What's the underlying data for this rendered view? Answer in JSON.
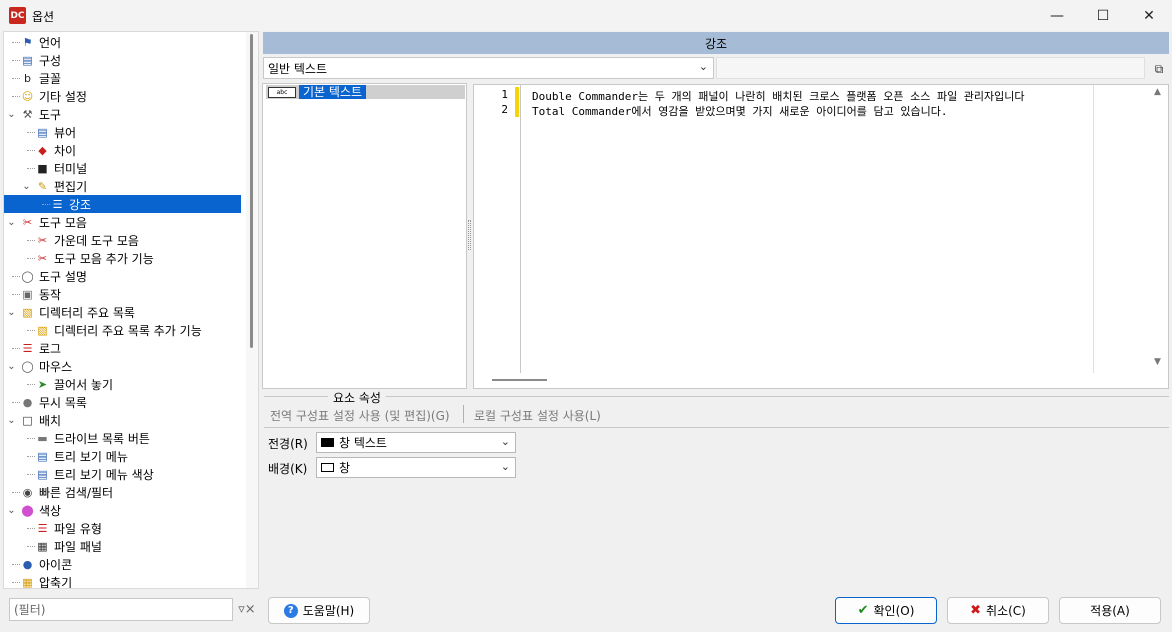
{
  "window": {
    "title": "옵션",
    "app_icon_text": "DC"
  },
  "header": {
    "title": "강조"
  },
  "syntax_combo": {
    "value": "일반 텍스트"
  },
  "tree": {
    "items": [
      {
        "label": "언어",
        "icon": "flag-icon",
        "level": 1
      },
      {
        "label": "구성",
        "icon": "config-icon",
        "level": 1
      },
      {
        "label": "글꼴",
        "icon": "font-icon",
        "level": 1
      },
      {
        "label": "기타 설정",
        "icon": "smiley-icon",
        "level": 1
      },
      {
        "label": "도구",
        "icon": "tools-icon",
        "level": 1,
        "expanded": true
      },
      {
        "label": "뷰어",
        "icon": "book-icon",
        "level": 2
      },
      {
        "label": "차이",
        "icon": "diff-icon",
        "level": 2
      },
      {
        "label": "터미널",
        "icon": "terminal-icon",
        "level": 2
      },
      {
        "label": "편집기",
        "icon": "editor-icon",
        "level": 2,
        "expanded": true
      },
      {
        "label": "강조",
        "icon": "list-icon",
        "level": 3,
        "selected": true
      },
      {
        "label": "도구 모음",
        "icon": "scissors-icon",
        "level": 1,
        "expanded": true
      },
      {
        "label": "가운데 도구 모음",
        "icon": "scissors-icon",
        "level": 2
      },
      {
        "label": "도구 모음 추가 기능",
        "icon": "scissors-icon",
        "level": 2
      },
      {
        "label": "도구 설명",
        "icon": "bulb-icon",
        "level": 1
      },
      {
        "label": "동작",
        "icon": "action-icon",
        "level": 1
      },
      {
        "label": "디렉터리 주요 목록",
        "icon": "folder-icon",
        "level": 1,
        "expanded": true
      },
      {
        "label": "디렉터리 주요 목록 추가 기능",
        "icon": "folder-icon",
        "level": 2
      },
      {
        "label": "로그",
        "icon": "log-icon",
        "level": 1
      },
      {
        "label": "마우스",
        "icon": "mouse-icon",
        "level": 1,
        "expanded": true
      },
      {
        "label": "끌어서 놓기",
        "icon": "drag-icon",
        "level": 2
      },
      {
        "label": "무시 목록",
        "icon": "ignore-icon",
        "level": 1
      },
      {
        "label": "배치",
        "icon": "layout-icon",
        "level": 1,
        "expanded": true
      },
      {
        "label": "드라이브 목록 버튼",
        "icon": "drive-icon",
        "level": 2
      },
      {
        "label": "트리 보기 메뉴",
        "icon": "tree-menu-icon",
        "level": 2
      },
      {
        "label": "트리 보기 메뉴 색상",
        "icon": "tree-menu-icon",
        "level": 2
      },
      {
        "label": "빠른 검색/필터",
        "icon": "binoculars-icon",
        "level": 1
      },
      {
        "label": "색상",
        "icon": "color-wheel-icon",
        "level": 1,
        "expanded": true
      },
      {
        "label": "파일 유형",
        "icon": "list-icon",
        "level": 2
      },
      {
        "label": "파일 패널",
        "icon": "panel-icon",
        "level": 2
      },
      {
        "label": "아이콘",
        "icon": "icons-icon",
        "level": 1
      },
      {
        "label": "압축기",
        "icon": "archive-icon",
        "level": 1
      }
    ]
  },
  "filter": {
    "placeholder": "(필터)"
  },
  "element_list": {
    "items": [
      {
        "label": "기본 텍스트",
        "icon_text": "abc"
      }
    ]
  },
  "editor": {
    "lines": [
      {
        "number": "1",
        "text": "Double Commander는 두 개의 패널이 나란히 배치된 크로스 플랫폼 오픈 소스 파일 관리자입니다"
      },
      {
        "number": "2",
        "text": "Total Commander에서 영감을 받았으며몇 가지 새로운 아이디어를 담고 있습니다."
      }
    ]
  },
  "properties": {
    "title": "요소 속성",
    "global_label": "전역 구성표 설정 사용 (및 편집)(G)",
    "local_label": "로컬 구성표 설정 사용(L)",
    "foreground": {
      "label": "전경(R)",
      "value": "창 텍스트",
      "swatch_color": "#000000"
    },
    "background": {
      "label": "배경(K)",
      "value": "창",
      "swatch_color": "#ffffff"
    }
  },
  "buttons": {
    "help": "도움말(H)",
    "ok": "확인(O)",
    "cancel": "취소(C)",
    "apply": "적용(A)"
  },
  "colors": {
    "accent": "#0a64d0",
    "header_bg": "#a6bcd6",
    "gutter_mark": "#f5d50a"
  }
}
